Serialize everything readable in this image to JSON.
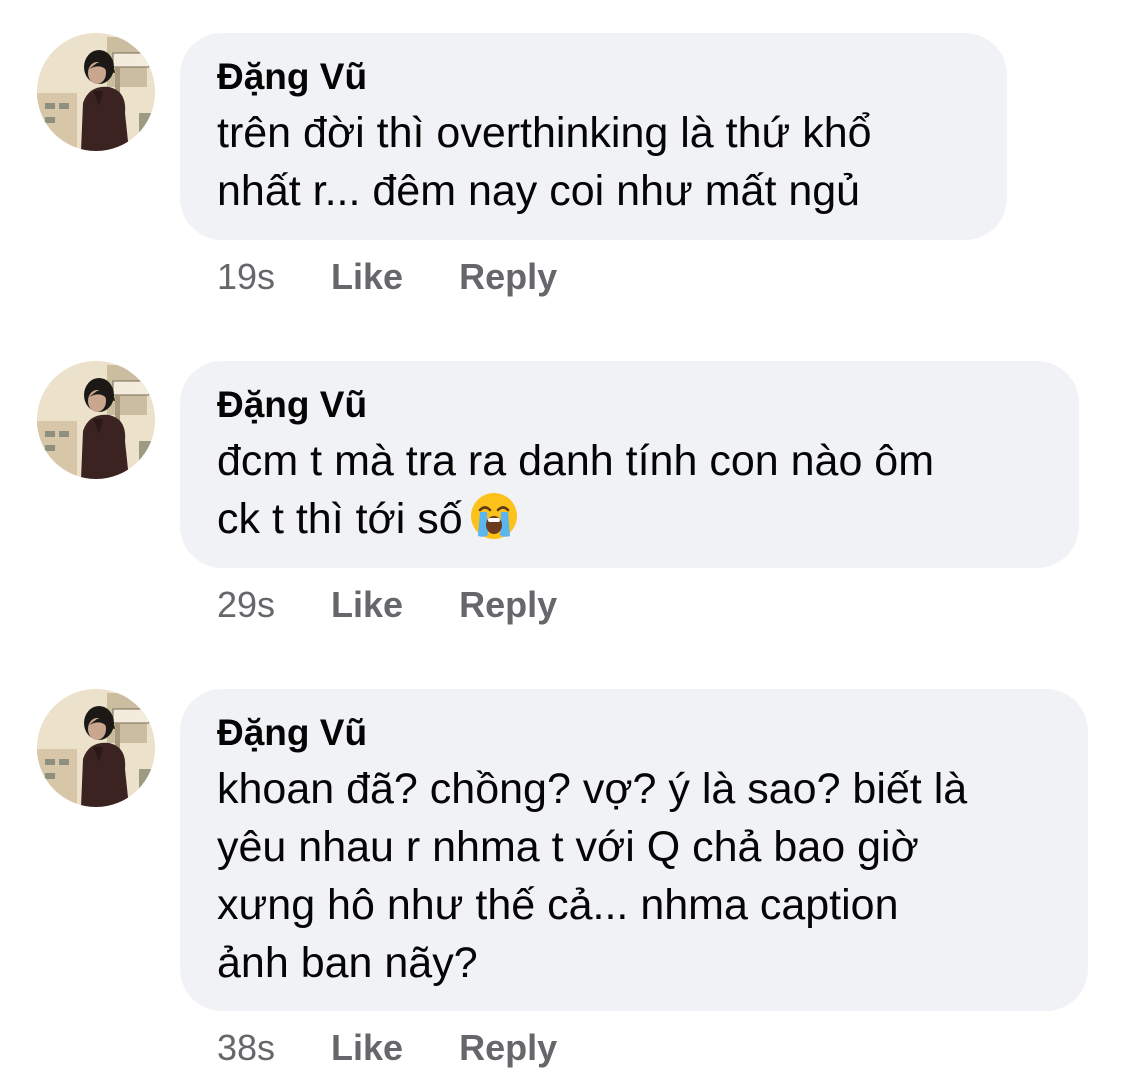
{
  "comments": [
    {
      "author": "Đặng Vũ",
      "lines": [
        "trên đời thì overthinking là thứ khổ",
        "nhất r... đêm nay coi như mất ngủ"
      ],
      "time": "19s",
      "like_label": "Like",
      "reply_label": "Reply"
    },
    {
      "author": "Đặng Vũ",
      "lines": [
        "đcm t mà tra ra danh tính con nào ôm",
        "ck t thì tới số"
      ],
      "emoji": "loudly-crying-face-icon",
      "time": "29s",
      "like_label": "Like",
      "reply_label": "Reply"
    },
    {
      "author": "Đặng Vũ",
      "lines": [
        "khoan đã? chồng? vợ? ý là sao? biết là",
        "yêu nhau r nhma t với Q chả bao giờ",
        "xưng hô như thế cả... nhma caption",
        "ảnh ban nãy?"
      ],
      "time": "38s",
      "like_label": "Like",
      "reply_label": "Reply"
    }
  ],
  "colors": {
    "bubble_bg": "#f0f2f5",
    "text": "#050505",
    "secondary_text": "#65676b"
  }
}
